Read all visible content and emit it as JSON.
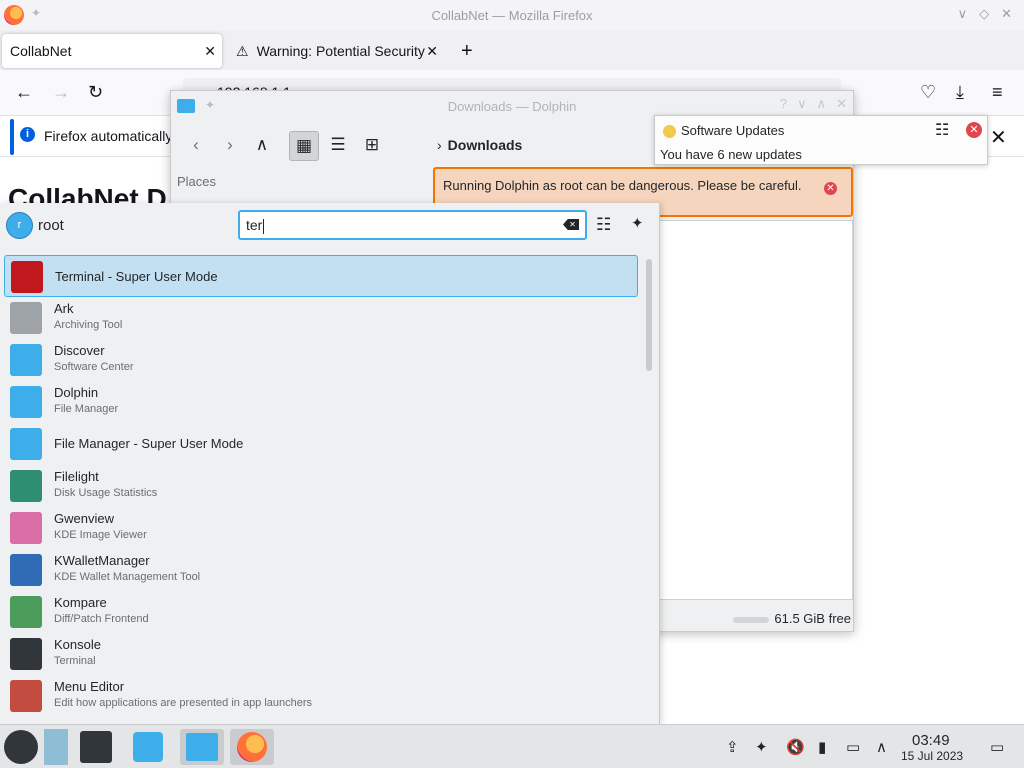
{
  "firefox": {
    "window_title": "CollabNet — Mozilla Firefox",
    "tabs": [
      {
        "label": "CollabNet"
      },
      {
        "label": "Warning: Potential Security"
      }
    ],
    "url": "192.168.1.1",
    "notice": "Firefox automatically",
    "page_heading": "CollabNet D"
  },
  "dolphin": {
    "window_title": "Downloads — Dolphin",
    "breadcrumb": "Downloads",
    "places_label": "Places",
    "warning": "Running Dolphin as root can be dangerous. Please be careful.",
    "free_space": "61.5 GiB free"
  },
  "notification": {
    "title": "Software Updates",
    "body": "You have 6 new updates"
  },
  "launcher": {
    "user_initial": "r",
    "user_name": "root",
    "search_value": "ter",
    "results": [
      {
        "name": "Terminal - Super User Mode",
        "desc": "",
        "icon": "terminal-su-icon",
        "color": "#c0181d",
        "selected": true
      },
      {
        "name": "Ark",
        "desc": "Archiving Tool",
        "icon": "ark-icon",
        "color": "#9ea3a8"
      },
      {
        "name": "Discover",
        "desc": "Software Center",
        "icon": "discover-icon",
        "color": "#3daee9"
      },
      {
        "name": "Dolphin",
        "desc": "File Manager",
        "icon": "dolphin-icon",
        "color": "#3daee9"
      },
      {
        "name": "File Manager - Super User Mode",
        "desc": "",
        "icon": "file-manager-su-icon",
        "color": "#3daee9"
      },
      {
        "name": "Filelight",
        "desc": "Disk Usage Statistics",
        "icon": "filelight-icon",
        "color": "#2d8f70"
      },
      {
        "name": "Gwenview",
        "desc": "KDE Image Viewer",
        "icon": "gwenview-icon",
        "color": "#d96fa6"
      },
      {
        "name": "KWalletManager",
        "desc": "KDE Wallet Management Tool",
        "icon": "kwallet-icon",
        "color": "#2f6cb5"
      },
      {
        "name": "Kompare",
        "desc": "Diff/Patch Frontend",
        "icon": "kompare-icon",
        "color": "#4c9c5c"
      },
      {
        "name": "Konsole",
        "desc": "Terminal",
        "icon": "konsole-icon",
        "color": "#31363b"
      },
      {
        "name": "Menu Editor",
        "desc": "Edit how applications are presented in app launchers",
        "icon": "menu-editor-icon",
        "color": "#c24c3f"
      }
    ]
  },
  "taskbar": {
    "clock_time": "03:49",
    "clock_date": "15 Jul 2023"
  }
}
